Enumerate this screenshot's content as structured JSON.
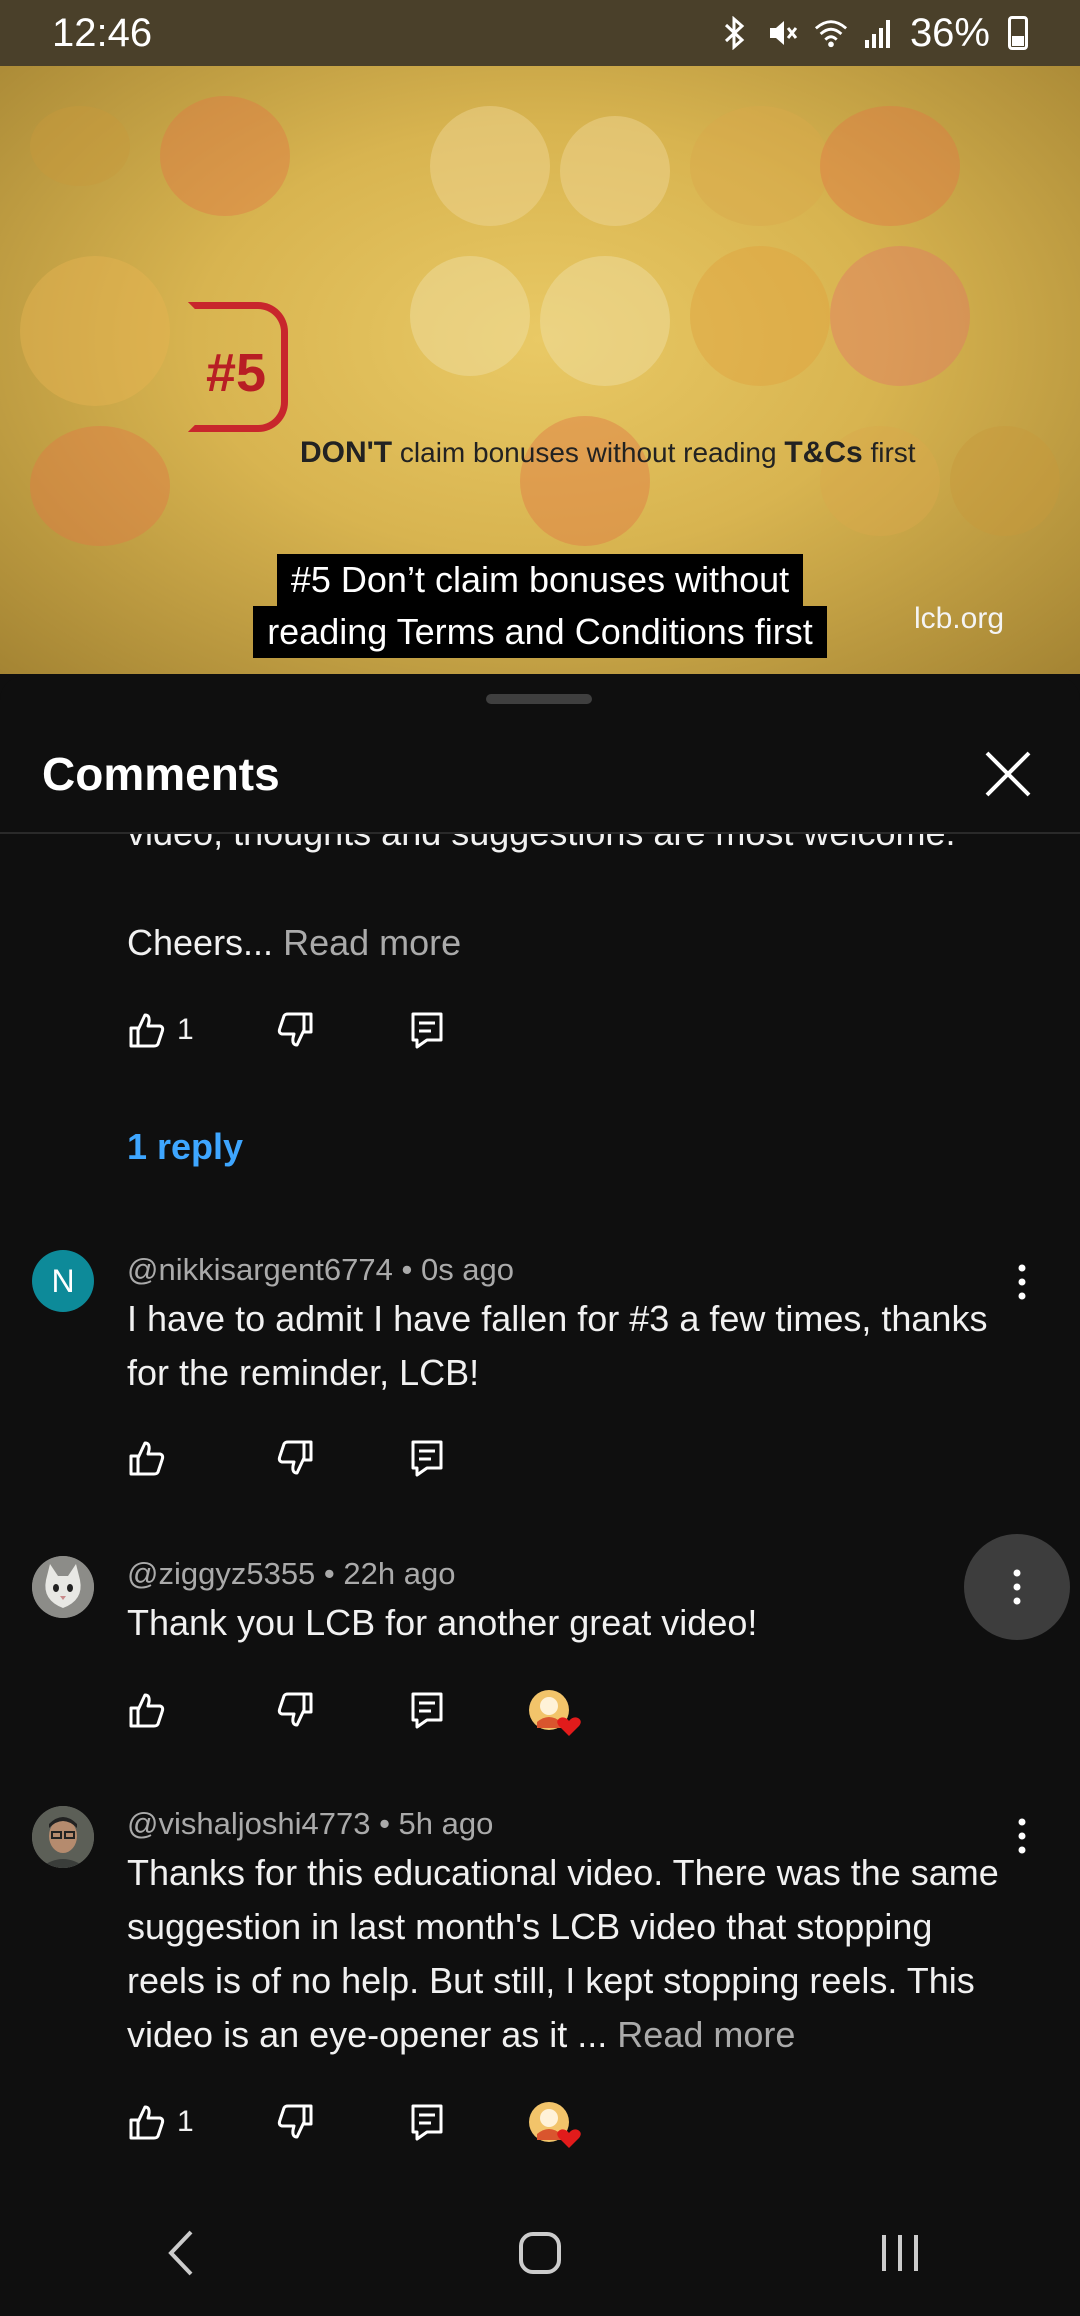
{
  "status_bar": {
    "time": "12:46",
    "battery": "36%",
    "icons": [
      "bluetooth-icon",
      "mute-icon",
      "wifi-icon",
      "signal-icon",
      "battery-icon"
    ]
  },
  "video": {
    "badge_number": "#5",
    "headline_strong": "DON'T",
    "headline_rest": "claim bonuses without reading",
    "headline_tc": "T&Cs",
    "headline_end": "first",
    "caption_line1": "#5 Don’t claim bonuses without",
    "caption_line2": "reading Terms and Conditions first",
    "watermark": "lcb.org"
  },
  "comments_panel": {
    "title": "Comments",
    "truncated_text": "video, thoughts and suggestions are most welcome.",
    "truncated_cheers": "Cheers...",
    "read_more": "Read more",
    "top_like_count": "1",
    "replies_link": "1 reply",
    "comments": [
      {
        "author": "@nikkisargent6774",
        "time": "0s ago",
        "avatar_letter": "N",
        "text": "I have to admit I have fallen for #3 a few times, thanks for the reminder, LCB!",
        "likes": ""
      },
      {
        "author": "@ziggyz5355",
        "time": "22h ago",
        "text": "Thank you LCB for another great video!",
        "likes": "",
        "creator_heart": true
      },
      {
        "author": "@vishaljoshi4773",
        "time": "5h ago",
        "text": "Thanks for this educational video. There was the same suggestion in last month's LCB video that stopping reels is of no help. But still, I kept stopping reels. This video is an eye-opener as it ...",
        "read_more": "Read more",
        "likes": "1",
        "creator_heart": true
      }
    ]
  },
  "colors": {
    "background": "#0f0f0f",
    "link_blue": "#3ea6ff",
    "heart_red": "#e21b1b",
    "avatar_teal": "#0d8a99"
  }
}
